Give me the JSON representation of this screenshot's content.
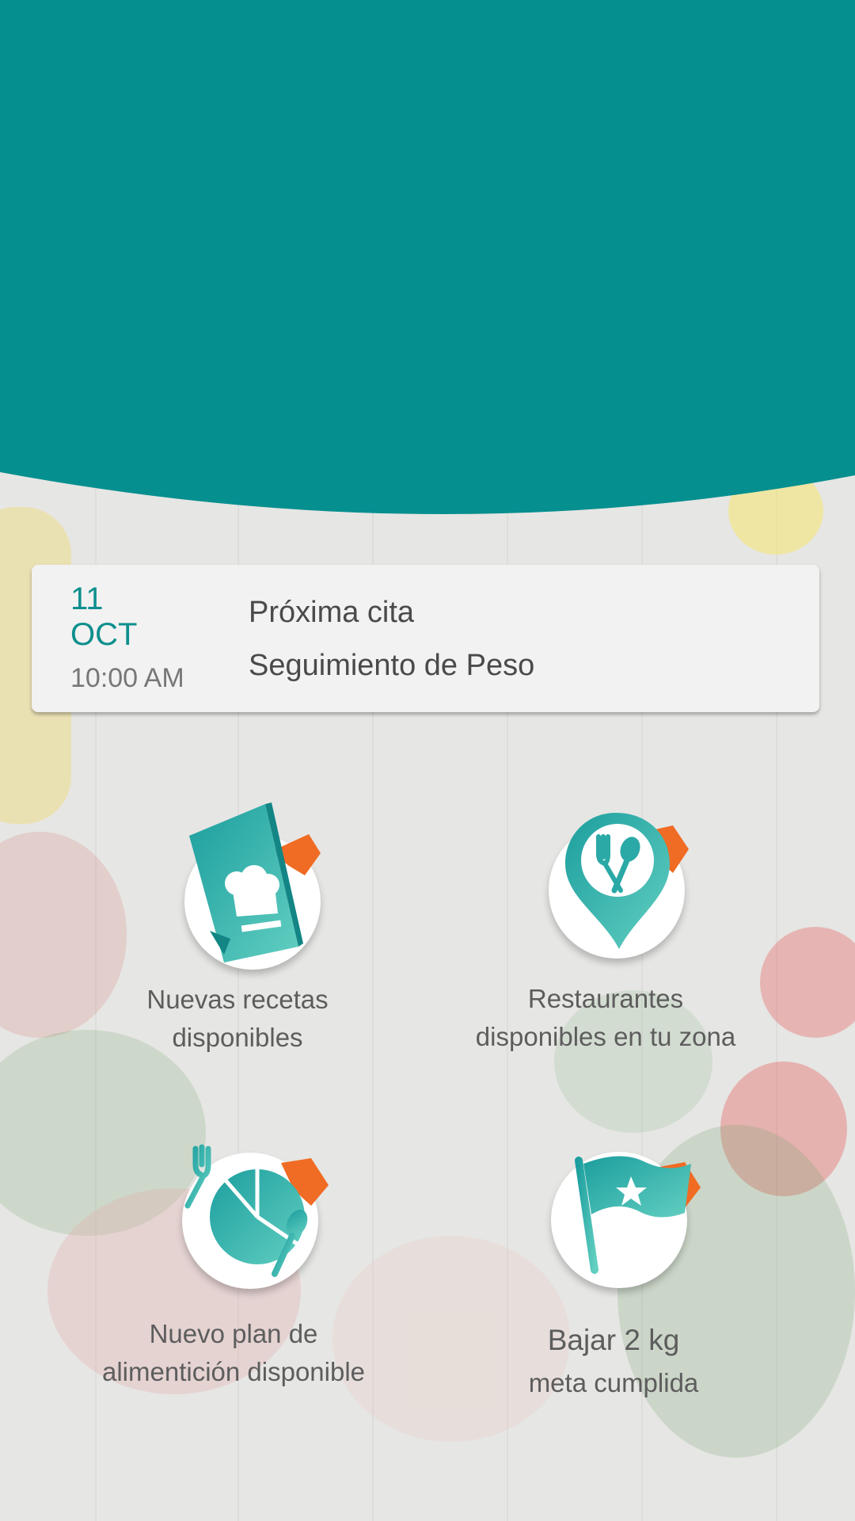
{
  "colors": {
    "header_teal": "#068f8f",
    "accent_teal": "#0d8f8d",
    "flag_orange": "#f06b23",
    "icon_teal_dark": "#1ea3a3",
    "icon_teal_light": "#5fcdc0"
  },
  "appointment": {
    "day": "11",
    "month": "OCT",
    "time": "10:00 AM",
    "title": "Próxima cita",
    "subtitle": "Seguimiento de Peso"
  },
  "tiles": [
    {
      "icon": "recipe-book-icon",
      "line1": "Nuevas recetas",
      "line2": "disponibles"
    },
    {
      "icon": "restaurant-location-icon",
      "line1": "Restaurantes",
      "line2": "disponibles en tu zona"
    },
    {
      "icon": "meal-plan-chart-icon",
      "line1": "Nuevo plan de",
      "line2": "alimentición disponible"
    },
    {
      "icon": "goal-flag-icon",
      "line1": "Bajar 2 kg",
      "line2": "meta cumplida"
    }
  ]
}
